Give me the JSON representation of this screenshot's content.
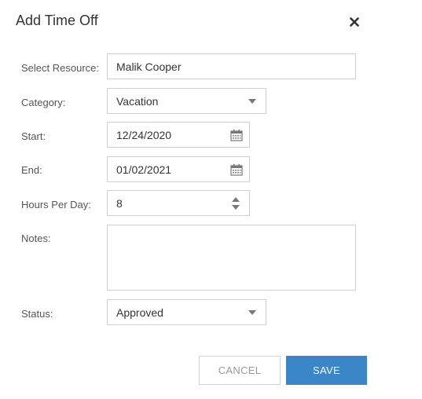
{
  "dialog": {
    "title": "Add Time Off",
    "close_icon": "close-icon"
  },
  "form": {
    "resource": {
      "label": "Select Resource:",
      "value": "Malik Cooper"
    },
    "category": {
      "label": "Category:",
      "value": "Vacation",
      "icon": "chevron-down-icon"
    },
    "start": {
      "label": "Start:",
      "value": "12/24/2020",
      "icon": "calendar-icon"
    },
    "end": {
      "label": "End:",
      "value": "01/02/2021",
      "icon": "calendar-icon"
    },
    "hours": {
      "label": "Hours Per Day:",
      "value": "8",
      "icon": "spinner-icon"
    },
    "notes": {
      "label": "Notes:",
      "value": ""
    },
    "status": {
      "label": "Status:",
      "value": "Approved",
      "icon": "chevron-down-icon"
    }
  },
  "buttons": {
    "cancel": "CANCEL",
    "save": "SAVE"
  },
  "colors": {
    "primary": "#3a86c8",
    "border": "#cfcfcf",
    "text": "#333333"
  }
}
